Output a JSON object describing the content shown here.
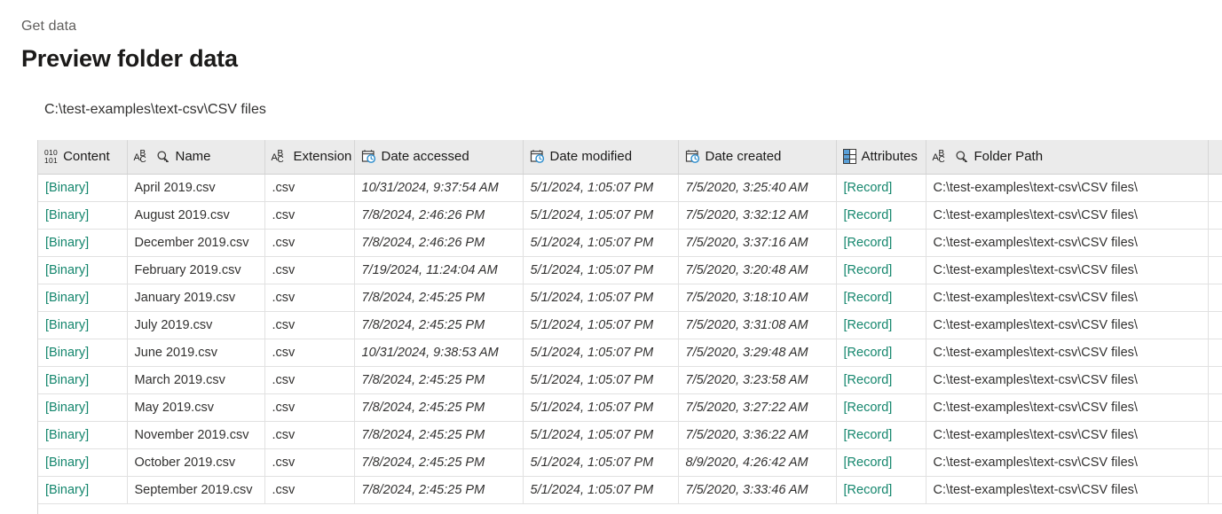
{
  "header": {
    "breadcrumb": "Get data",
    "title": "Preview folder data",
    "folder_path": "C:\\test-examples\\text-csv\\CSV files"
  },
  "colors": {
    "link_teal": "#14866d",
    "header_bg": "#ebebeb",
    "icon_blue": "#5aa0d8",
    "text": "#323130",
    "muted": "#605e5c"
  },
  "table": {
    "columns": [
      {
        "label": "Content",
        "icon": "binary-icon",
        "align": "left"
      },
      {
        "label": "Name",
        "icon": "abc-search-icon",
        "align": "left"
      },
      {
        "label": "Extension",
        "icon": "abc-icon",
        "align": "left"
      },
      {
        "label": "Date accessed",
        "icon": "calendar-clock-icon",
        "align": "right"
      },
      {
        "label": "Date modified",
        "icon": "calendar-clock-icon",
        "align": "right"
      },
      {
        "label": "Date created",
        "icon": "calendar-clock-icon",
        "align": "right"
      },
      {
        "label": "Attributes",
        "icon": "record-table-icon",
        "align": "left"
      },
      {
        "label": "Folder Path",
        "icon": "abc-search-icon",
        "align": "left"
      }
    ],
    "binary_icon_text": {
      "top": "010",
      "bottom": "101"
    },
    "abc_icon_text": {
      "a": "A",
      "b": "B",
      "c": "C"
    },
    "rows": [
      {
        "content": "[Binary]",
        "name": "April 2019.csv",
        "extension": ".csv",
        "date_accessed": "10/31/2024, 9:37:54 AM",
        "date_modified": "5/1/2024, 1:05:07 PM",
        "date_created": "7/5/2020, 3:25:40 AM",
        "attributes": "[Record]",
        "folder_path": "C:\\test-examples\\text-csv\\CSV files\\"
      },
      {
        "content": "[Binary]",
        "name": "August 2019.csv",
        "extension": ".csv",
        "date_accessed": "7/8/2024, 2:46:26 PM",
        "date_modified": "5/1/2024, 1:05:07 PM",
        "date_created": "7/5/2020, 3:32:12 AM",
        "attributes": "[Record]",
        "folder_path": "C:\\test-examples\\text-csv\\CSV files\\"
      },
      {
        "content": "[Binary]",
        "name": "December 2019.csv",
        "extension": ".csv",
        "date_accessed": "7/8/2024, 2:46:26 PM",
        "date_modified": "5/1/2024, 1:05:07 PM",
        "date_created": "7/5/2020, 3:37:16 AM",
        "attributes": "[Record]",
        "folder_path": "C:\\test-examples\\text-csv\\CSV files\\"
      },
      {
        "content": "[Binary]",
        "name": "February 2019.csv",
        "extension": ".csv",
        "date_accessed": "7/19/2024, 11:24:04 AM",
        "date_modified": "5/1/2024, 1:05:07 PM",
        "date_created": "7/5/2020, 3:20:48 AM",
        "attributes": "[Record]",
        "folder_path": "C:\\test-examples\\text-csv\\CSV files\\"
      },
      {
        "content": "[Binary]",
        "name": "January 2019.csv",
        "extension": ".csv",
        "date_accessed": "7/8/2024, 2:45:25 PM",
        "date_modified": "5/1/2024, 1:05:07 PM",
        "date_created": "7/5/2020, 3:18:10 AM",
        "attributes": "[Record]",
        "folder_path": "C:\\test-examples\\text-csv\\CSV files\\"
      },
      {
        "content": "[Binary]",
        "name": "July 2019.csv",
        "extension": ".csv",
        "date_accessed": "7/8/2024, 2:45:25 PM",
        "date_modified": "5/1/2024, 1:05:07 PM",
        "date_created": "7/5/2020, 3:31:08 AM",
        "attributes": "[Record]",
        "folder_path": "C:\\test-examples\\text-csv\\CSV files\\"
      },
      {
        "content": "[Binary]",
        "name": "June 2019.csv",
        "extension": ".csv",
        "date_accessed": "10/31/2024, 9:38:53 AM",
        "date_modified": "5/1/2024, 1:05:07 PM",
        "date_created": "7/5/2020, 3:29:48 AM",
        "attributes": "[Record]",
        "folder_path": "C:\\test-examples\\text-csv\\CSV files\\"
      },
      {
        "content": "[Binary]",
        "name": "March 2019.csv",
        "extension": ".csv",
        "date_accessed": "7/8/2024, 2:45:25 PM",
        "date_modified": "5/1/2024, 1:05:07 PM",
        "date_created": "7/5/2020, 3:23:58 AM",
        "attributes": "[Record]",
        "folder_path": "C:\\test-examples\\text-csv\\CSV files\\"
      },
      {
        "content": "[Binary]",
        "name": "May 2019.csv",
        "extension": ".csv",
        "date_accessed": "7/8/2024, 2:45:25 PM",
        "date_modified": "5/1/2024, 1:05:07 PM",
        "date_created": "7/5/2020, 3:27:22 AM",
        "attributes": "[Record]",
        "folder_path": "C:\\test-examples\\text-csv\\CSV files\\"
      },
      {
        "content": "[Binary]",
        "name": "November 2019.csv",
        "extension": ".csv",
        "date_accessed": "7/8/2024, 2:45:25 PM",
        "date_modified": "5/1/2024, 1:05:07 PM",
        "date_created": "7/5/2020, 3:36:22 AM",
        "attributes": "[Record]",
        "folder_path": "C:\\test-examples\\text-csv\\CSV files\\"
      },
      {
        "content": "[Binary]",
        "name": "October 2019.csv",
        "extension": ".csv",
        "date_accessed": "7/8/2024, 2:45:25 PM",
        "date_modified": "5/1/2024, 1:05:07 PM",
        "date_created": "8/9/2020, 4:26:42 AM",
        "attributes": "[Record]",
        "folder_path": "C:\\test-examples\\text-csv\\CSV files\\"
      },
      {
        "content": "[Binary]",
        "name": "September 2019.csv",
        "extension": ".csv",
        "date_accessed": "7/8/2024, 2:45:25 PM",
        "date_modified": "5/1/2024, 1:05:07 PM",
        "date_created": "7/5/2020, 3:33:46 AM",
        "attributes": "[Record]",
        "folder_path": "C:\\test-examples\\text-csv\\CSV files\\"
      }
    ]
  }
}
